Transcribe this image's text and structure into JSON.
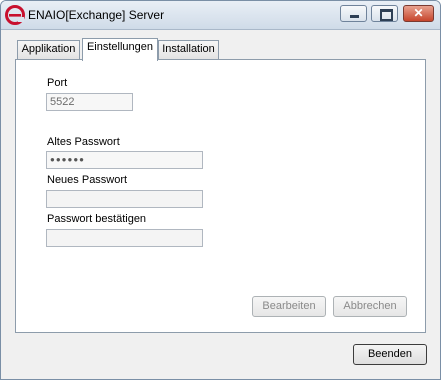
{
  "window": {
    "title": "ENAIO[Exchange] Server",
    "close_glyph": "✕"
  },
  "tabs": [
    {
      "label": "Applikation"
    },
    {
      "label": "Einstellungen"
    },
    {
      "label": "Installation"
    }
  ],
  "settings": {
    "port_label": "Port",
    "port_value": "5522",
    "old_password_label": "Altes Passwort",
    "old_password_value": "●●●●●●",
    "new_password_label": "Neues Passwort",
    "new_password_value": "",
    "confirm_password_label": "Passwort bestätigen",
    "confirm_password_value": ""
  },
  "buttons": {
    "edit": "Bearbeiten",
    "cancel": "Abbrechen",
    "exit": "Beenden"
  },
  "colors": {
    "icon_red": "#c8102e"
  }
}
